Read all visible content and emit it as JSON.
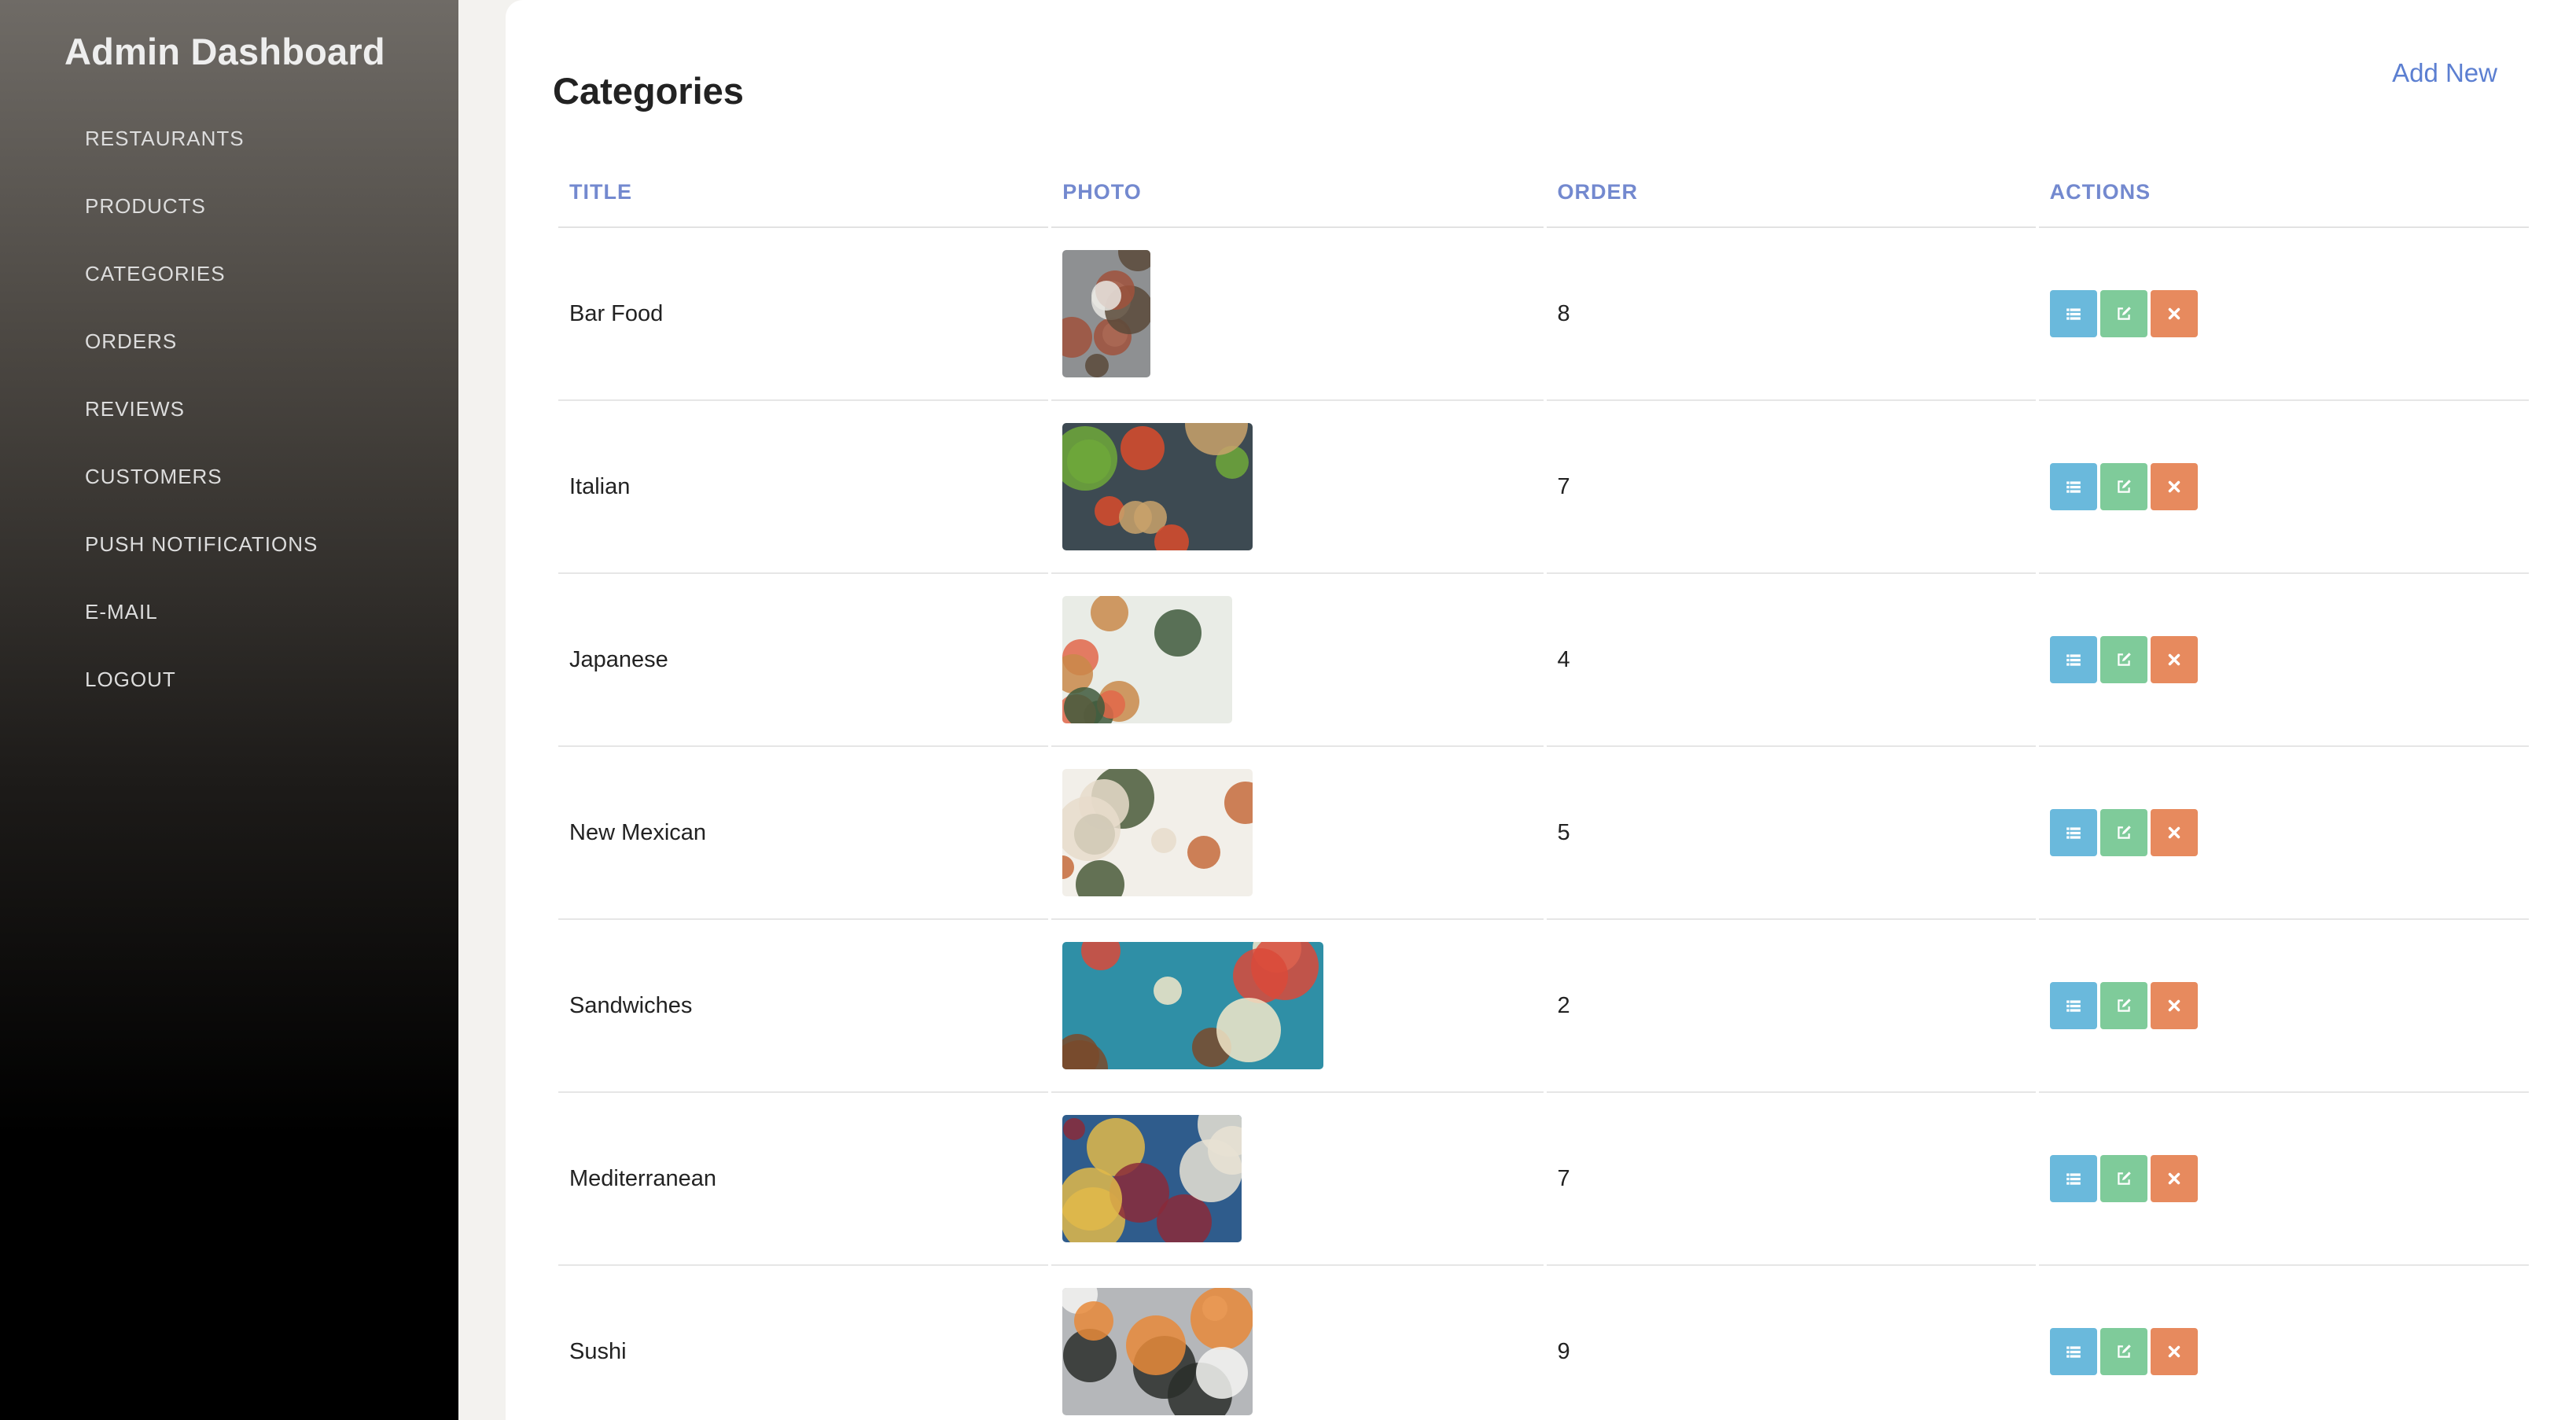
{
  "sidebar": {
    "brand": "Admin Dashboard",
    "items": [
      {
        "label": "RESTAURANTS"
      },
      {
        "label": "PRODUCTS"
      },
      {
        "label": "CATEGORIES"
      },
      {
        "label": "ORDERS"
      },
      {
        "label": "REVIEWS"
      },
      {
        "label": "CUSTOMERS"
      },
      {
        "label": "PUSH NOTIFICATIONS"
      },
      {
        "label": "E-MAIL"
      },
      {
        "label": "LOGOUT"
      }
    ]
  },
  "main": {
    "title": "Categories",
    "add_new_label": "Add New",
    "columns": {
      "title": "TITLE",
      "photo": "PHOTO",
      "order": "ORDER",
      "actions": "ACTIONS"
    },
    "rows": [
      {
        "title": "Bar Food",
        "order": "8",
        "photo_alt": "Bar Food",
        "photo_palette": [
          "#8e9092",
          "#e8e6e2",
          "#5a4a3a",
          "#a0523c"
        ]
      },
      {
        "title": "Italian",
        "order": "7",
        "photo_alt": "Italian",
        "photo_palette": [
          "#3d4a52",
          "#c9a26b",
          "#d94b2b",
          "#6fa83a"
        ]
      },
      {
        "title": "Japanese",
        "order": "4",
        "photo_alt": "Japanese",
        "photo_palette": [
          "#e9ece6",
          "#c98a4a",
          "#e2674a",
          "#3f5a3c"
        ]
      },
      {
        "title": "New Mexican",
        "order": "5",
        "photo_alt": "New Mexican",
        "photo_palette": [
          "#f2efe9",
          "#4a5a3a",
          "#c56b3c",
          "#e8dccb"
        ]
      },
      {
        "title": "Sandwiches",
        "order": "2",
        "photo_alt": "Sandwiches",
        "photo_palette": [
          "#2f8fa6",
          "#7a4a2a",
          "#f2e7c9",
          "#d94a3a"
        ]
      },
      {
        "title": "Mediterranean",
        "order": "7",
        "photo_alt": "Mediterranean",
        "photo_palette": [
          "#2f5c8c",
          "#e8e2d4",
          "#8a2a3a",
          "#e0b84a"
        ]
      },
      {
        "title": "Sushi",
        "order": "9",
        "photo_alt": "Sushi",
        "photo_palette": [
          "#b5b7ba",
          "#f4f4f2",
          "#2a2e2a",
          "#e88a3a"
        ]
      }
    ]
  },
  "colors": {
    "accent": "#5c7fd1",
    "header_text": "#7389cf",
    "btn_list": "#6ab9dc",
    "btn_edit": "#7fcb9a",
    "btn_delete": "#e78a5e"
  },
  "icons": {
    "list": "list-icon",
    "edit": "edit-icon",
    "delete": "close-icon"
  }
}
